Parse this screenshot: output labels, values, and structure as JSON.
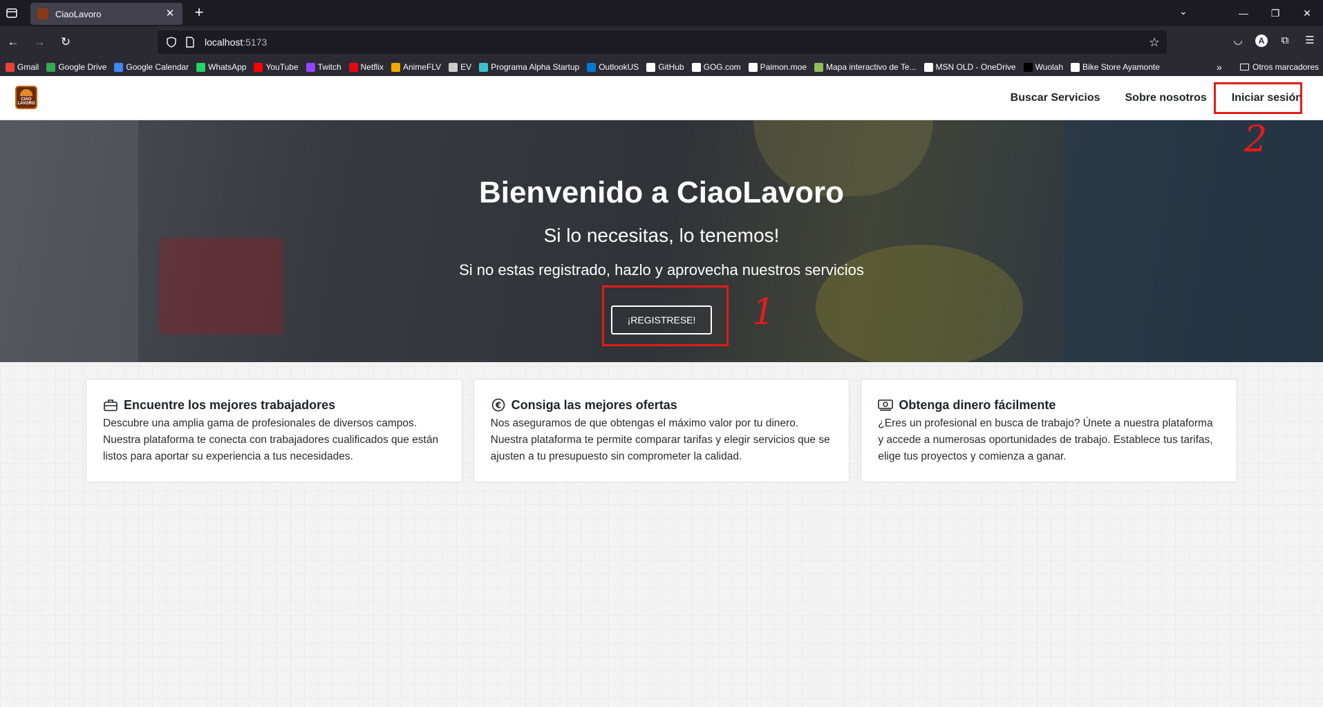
{
  "browser": {
    "tab_title": "CiaoLavoro",
    "url_host": "localhost",
    "url_port": ":5173",
    "bookmarks": [
      {
        "label": "Gmail",
        "color": "#ea4335"
      },
      {
        "label": "Google Drive",
        "color": "#34a853"
      },
      {
        "label": "Google Calendar",
        "color": "#4285f4"
      },
      {
        "label": "WhatsApp",
        "color": "#25d366"
      },
      {
        "label": "YouTube",
        "color": "#ff0000"
      },
      {
        "label": "Twitch",
        "color": "#9146ff"
      },
      {
        "label": "Netflix",
        "color": "#e50914"
      },
      {
        "label": "AnimeFLV",
        "color": "#f2a900"
      },
      {
        "label": "EV",
        "color": "#cccccc"
      },
      {
        "label": "Programa Alpha Startup",
        "color": "#3fc1c9"
      },
      {
        "label": "OutlookUS",
        "color": "#0078d4"
      },
      {
        "label": "GitHub",
        "color": "#ffffff"
      },
      {
        "label": "GOG.com",
        "color": "#ffffff"
      },
      {
        "label": "Paimon.moe",
        "color": "#ffffff"
      },
      {
        "label": "Mapa interactivo de Te...",
        "color": "#8fbc5a"
      },
      {
        "label": "MSN OLD - OneDrive",
        "color": "#ffffff"
      },
      {
        "label": "Wuolah",
        "color": "#000000"
      },
      {
        "label": "Bike Store Ayamonte",
        "color": "#ffffff"
      }
    ],
    "other_bookmarks": "Otros marcadores"
  },
  "site": {
    "logo_text": "CIAO LAVORO",
    "nav": {
      "search": "Buscar Servicios",
      "about": "Sobre nosotros",
      "login": "Iniciar sesión"
    },
    "hero": {
      "title": "Bienvenido a CiaoLavoro",
      "subtitle": "Si lo necesitas, lo tenemos!",
      "text": "Si no estas registrado, hazlo y aprovecha nuestros servicios",
      "button": "¡REGISTRESE!"
    },
    "features": [
      {
        "icon": "briefcase-icon",
        "title": "Encuentre los mejores trabajadores",
        "text": "Descubre una amplia gama de profesionales de diversos campos. Nuestra plataforma te conecta con trabajadores cualificados que están listos para aportar su experiencia a tus necesidades."
      },
      {
        "icon": "euro-icon",
        "title": "Consiga las mejores ofertas",
        "text": "Nos aseguramos de que obtengas el máximo valor por tu dinero. Nuestra plataforma te permite comparar tarifas y elegir servicios que se ajusten a tu presupuesto sin comprometer la calidad."
      },
      {
        "icon": "cash-icon",
        "title": "Obtenga dinero fácilmente",
        "text": "¿Eres un profesional en busca de trabajo? Únete a nuestra plataforma y accede a numerosas oportunidades de trabajo. Establece tus tarifas, elige tus proyectos y comienza a ganar."
      }
    ]
  },
  "annotations": {
    "step1": "1",
    "step2": "2",
    "color": "#e41b1b"
  }
}
